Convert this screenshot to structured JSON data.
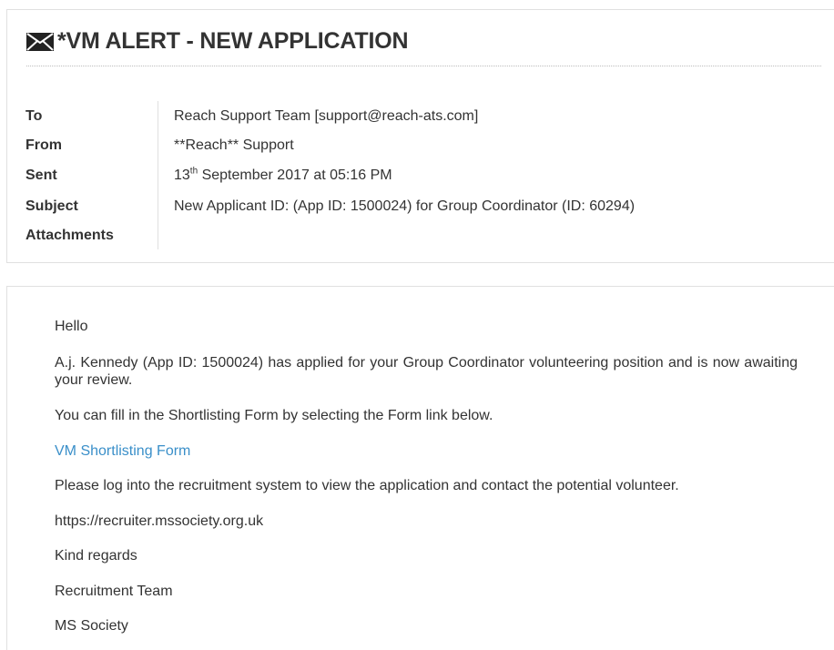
{
  "email": {
    "title": "*VM ALERT - NEW APPLICATION",
    "title_icon": "envelope-icon",
    "labels": {
      "to": "To",
      "from": "From",
      "sent": "Sent",
      "subject": "Subject",
      "attachments": "Attachments"
    },
    "to": "Reach Support Team [support@reach-ats.com]",
    "from": "**Reach** Support",
    "sent": {
      "day": "13",
      "suffix": "th",
      "rest": " September 2017 at 05:16 PM"
    },
    "subject": "New Applicant ID: (App ID: 1500024) for Group Coordinator (ID: 60294)",
    "attachments": ""
  },
  "message": {
    "greeting": "Hello",
    "paragraph1": "A.j. Kennedy (App ID: 1500024) has applied for your Group Coordinator volunteering position and is now awaiting your review.",
    "paragraph2": "You can fill in the Shortlisting Form by selecting the Form link below.",
    "form_link": "VM Shortlisting Form",
    "paragraph3": "Please log into the recruitment system to view the application and contact the potential volunteer.",
    "url": "https://recruiter.mssociety.org.uk",
    "signoff": "Kind regards",
    "team": "Recruitment Team",
    "org": "MS Society"
  },
  "colors": {
    "text": "#333333",
    "link": "#3a8fc9",
    "border": "#e0e0e0"
  }
}
